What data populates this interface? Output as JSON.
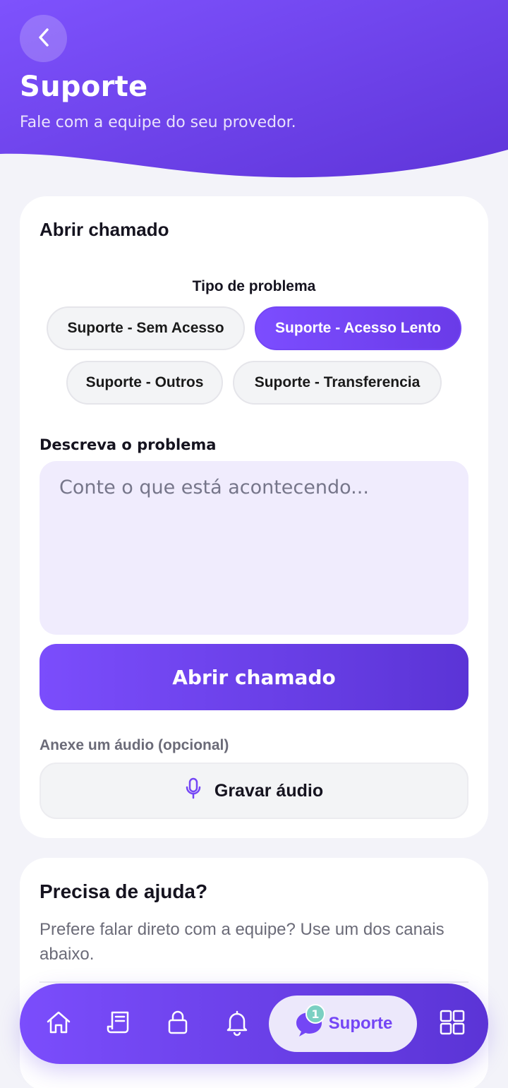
{
  "header": {
    "title": "Suporte",
    "subtitle": "Fale com a equipe do seu provedor."
  },
  "ticket_form": {
    "heading": "Abrir chamado",
    "problem_type_label": "Tipo de problema",
    "problem_types": [
      {
        "label": "Suporte - Sem Acesso",
        "selected": false
      },
      {
        "label": "Suporte - Acesso Lento",
        "selected": true
      },
      {
        "label": "Suporte - Outros",
        "selected": false
      },
      {
        "label": "Suporte - Transferencia",
        "selected": false
      }
    ],
    "description_label": "Descreva o problema",
    "description_placeholder": "Conte o que está acontecendo...",
    "submit_label": "Abrir chamado",
    "audio_label": "Anexe um áudio (opcional)",
    "record_audio_label": "Gravar áudio"
  },
  "help": {
    "heading": "Precisa de ajuda?",
    "description": "Prefere falar direto com a equipe? Use um dos canais abaixo."
  },
  "bottom_nav": {
    "items": [
      {
        "name": "home",
        "icon": "home-icon"
      },
      {
        "name": "invoices",
        "icon": "receipt-icon"
      },
      {
        "name": "unlock",
        "icon": "lock-icon"
      },
      {
        "name": "notifications",
        "icon": "bell-icon"
      },
      {
        "name": "support",
        "icon": "chat-bubble-icon"
      },
      {
        "name": "menu",
        "icon": "grid-icon"
      }
    ],
    "active_label": "Suporte",
    "support_badge": "1"
  },
  "colors": {
    "primary": "#7446f5",
    "primary_dark": "#5b34d6",
    "background": "#f3f3f9",
    "badge": "#7bd0c2"
  }
}
